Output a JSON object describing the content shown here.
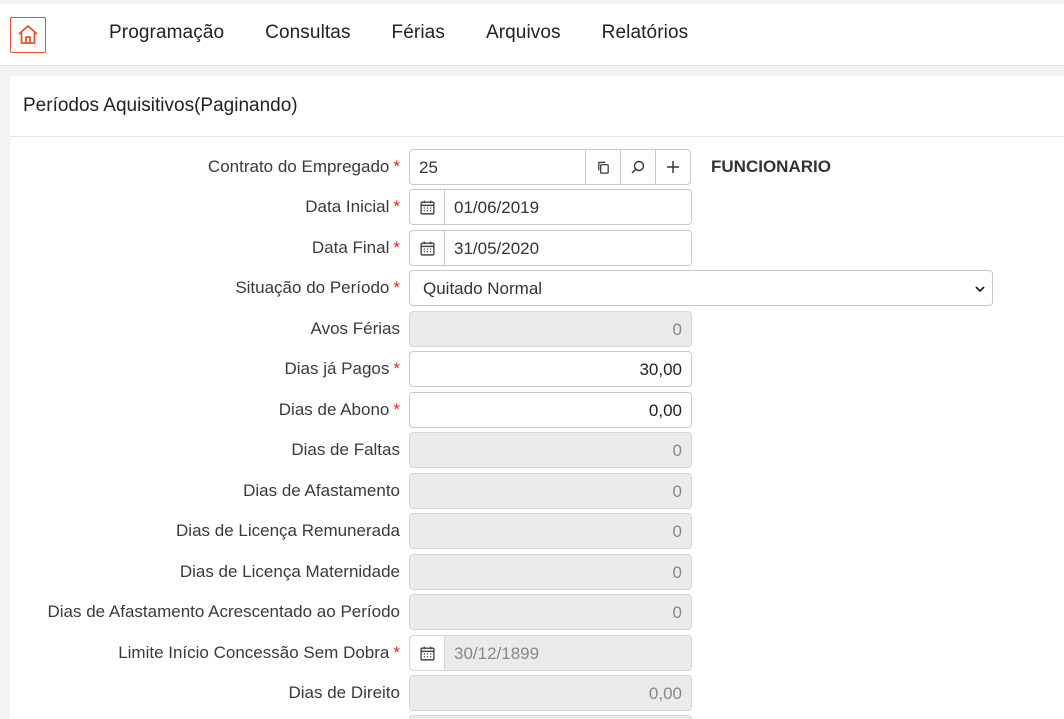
{
  "nav": {
    "items": [
      "Programação",
      "Consultas",
      "Férias",
      "Arquivos",
      "Relatórios"
    ]
  },
  "panel": {
    "title": "Períodos Aquisitivos(Paginando)"
  },
  "form": {
    "contrato": {
      "label": "Contrato do Empregado",
      "value": "25",
      "employee": "FUNCIONARIO"
    },
    "data_inicial": {
      "label": "Data Inicial",
      "value": "01/06/2019"
    },
    "data_final": {
      "label": "Data Final",
      "value": "31/05/2020"
    },
    "situacao": {
      "label": "Situação do Período",
      "value": "Quitado Normal"
    },
    "avos_ferias": {
      "label": "Avos Férias",
      "value": "0"
    },
    "dias_pagos": {
      "label": "Dias já Pagos",
      "value": "30,00"
    },
    "dias_abono": {
      "label": "Dias de Abono",
      "value": "0,00"
    },
    "dias_faltas": {
      "label": "Dias de Faltas",
      "value": "0"
    },
    "dias_afastamento": {
      "label": "Dias de Afastamento",
      "value": "0"
    },
    "licenca_remunerada": {
      "label": "Dias de Licença Remunerada",
      "value": "0"
    },
    "licenca_maternidade": {
      "label": "Dias de Licença Maternidade",
      "value": "0"
    },
    "afastamento_acrescentado": {
      "label": "Dias de Afastamento Acrescentado ao Período",
      "value": "0"
    },
    "limite_concessao": {
      "label": "Limite Início Concessão Sem Dobra",
      "value": "30/12/1899"
    },
    "dias_direito": {
      "label": "Dias de Direito",
      "value": "0,00"
    }
  },
  "colors": {
    "accent": "#e2542b",
    "required": "#e0262b",
    "disabled_bg": "#ebebeb"
  },
  "icons": {
    "home": "home-icon",
    "calendar": "calendar-icon",
    "copy": "copy-icon",
    "search": "search-icon",
    "add": "plus-icon",
    "dropdown": "chevron-down-icon"
  }
}
